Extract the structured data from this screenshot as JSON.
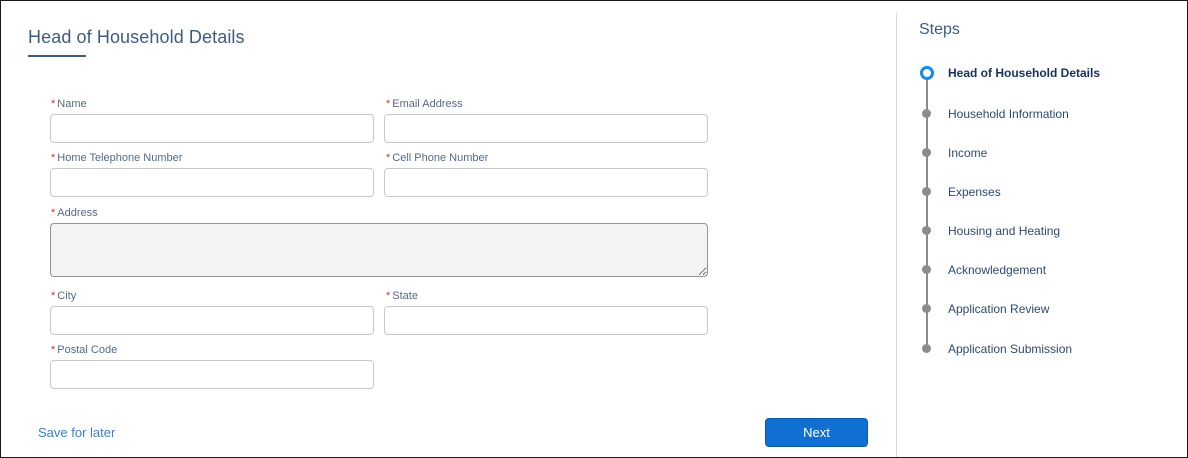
{
  "form": {
    "title": "Head of Household Details",
    "required_mark": "*",
    "fields": {
      "name": {
        "label": "Name",
        "value": ""
      },
      "email": {
        "label": "Email Address",
        "value": ""
      },
      "home_phone": {
        "label": "Home Telephone Number",
        "value": ""
      },
      "cell_phone": {
        "label": "Cell Phone Number",
        "value": ""
      },
      "address": {
        "label": "Address",
        "value": ""
      },
      "city": {
        "label": "City",
        "value": ""
      },
      "state": {
        "label": "State",
        "value": ""
      },
      "postal_code": {
        "label": "Postal Code",
        "value": ""
      }
    },
    "save_label": "Save for later",
    "next_label": "Next"
  },
  "steps": {
    "title": "Steps",
    "items": [
      {
        "label": "Head of Household Details",
        "status": "current"
      },
      {
        "label": "Household Information",
        "status": "upcoming"
      },
      {
        "label": "Income",
        "status": "upcoming"
      },
      {
        "label": "Expenses",
        "status": "upcoming"
      },
      {
        "label": "Housing and Heating",
        "status": "upcoming"
      },
      {
        "label": "Acknowledgement",
        "status": "upcoming"
      },
      {
        "label": "Application Review",
        "status": "upcoming"
      },
      {
        "label": "Application Submission",
        "status": "upcoming"
      }
    ]
  },
  "colors": {
    "accent": "#0f6fd2",
    "current_step_ring": "#1589ee",
    "required": "#c23934",
    "title": "#3f5c80"
  }
}
